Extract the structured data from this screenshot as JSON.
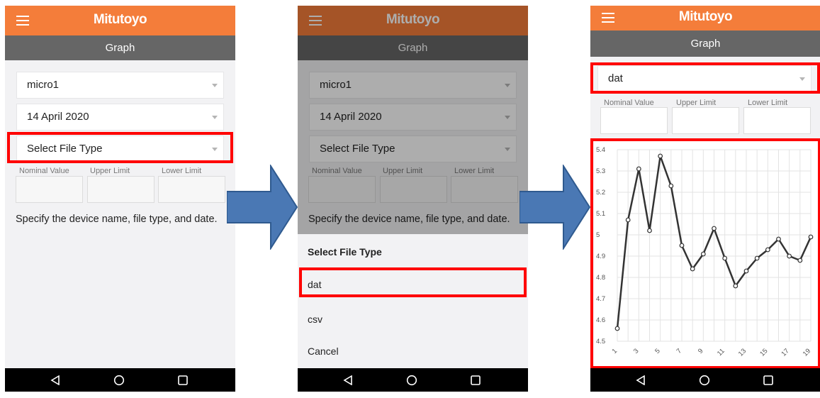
{
  "screens": [
    {
      "app_title": "Mitutoyo",
      "screen_title": "Graph",
      "device_select": "micro1",
      "date_select": "14 April 2020",
      "file_type_select": "Select File Type",
      "limits": {
        "nominal_label": "Nominal Value",
        "upper_label": "Upper Limit",
        "lower_label": "Lower Limit"
      },
      "hint": "Specify the device name, file type, and date."
    },
    {
      "app_title": "Mitutoyo",
      "screen_title": "Graph",
      "device_select": "micro1",
      "date_select": "14 April 2020",
      "file_type_select": "Select File Type",
      "limits": {
        "nominal_label": "Nominal Value",
        "upper_label": "Upper Limit",
        "lower_label": "Lower Limit"
      },
      "hint": "Specify the device name, file type, and date.",
      "sheet": {
        "title": "Select File Type",
        "options": [
          "dat",
          "csv"
        ],
        "cancel": "Cancel"
      }
    },
    {
      "app_title": "Mitutoyo",
      "screen_title": "Graph",
      "file_type_select": "dat",
      "limits": {
        "nominal_label": "Nominal Value",
        "upper_label": "Upper Limit",
        "lower_label": "Lower Limit"
      }
    }
  ],
  "colors": {
    "app_bar": "#f47d3a",
    "sub_bar": "#666666",
    "highlight": "#ff0000",
    "arrow": "#4a78b4",
    "line": "#333333"
  },
  "icons": {
    "menu": "hamburger-icon",
    "back": "back-triangle-icon",
    "home": "home-circle-icon",
    "recent": "recent-square-icon",
    "arrow": "right-arrow-icon"
  },
  "chart_data": {
    "type": "line",
    "x": [
      1,
      2,
      3,
      4,
      5,
      6,
      7,
      8,
      9,
      10,
      11,
      12,
      13,
      14,
      15,
      16,
      17,
      18,
      19
    ],
    "series": [
      {
        "values": [
          4.56,
          5.07,
          5.31,
          5.02,
          5.37,
          5.23,
          4.95,
          4.84,
          4.91,
          5.03,
          4.89,
          4.76,
          4.83,
          4.89,
          4.93,
          4.98,
          4.9,
          4.88,
          4.99
        ]
      }
    ],
    "ylim": [
      4.5,
      5.4
    ],
    "y_ticks": [
      "4.5",
      "4.6",
      "4.7",
      "4.8",
      "4.9",
      "5",
      "5.1",
      "5.2",
      "5.3",
      "5.4"
    ],
    "x_ticks": [
      "1",
      "3",
      "5",
      "7",
      "9",
      "11",
      "13",
      "15",
      "17",
      "19"
    ],
    "grid": true,
    "title": "",
    "xlabel": "",
    "ylabel": ""
  }
}
